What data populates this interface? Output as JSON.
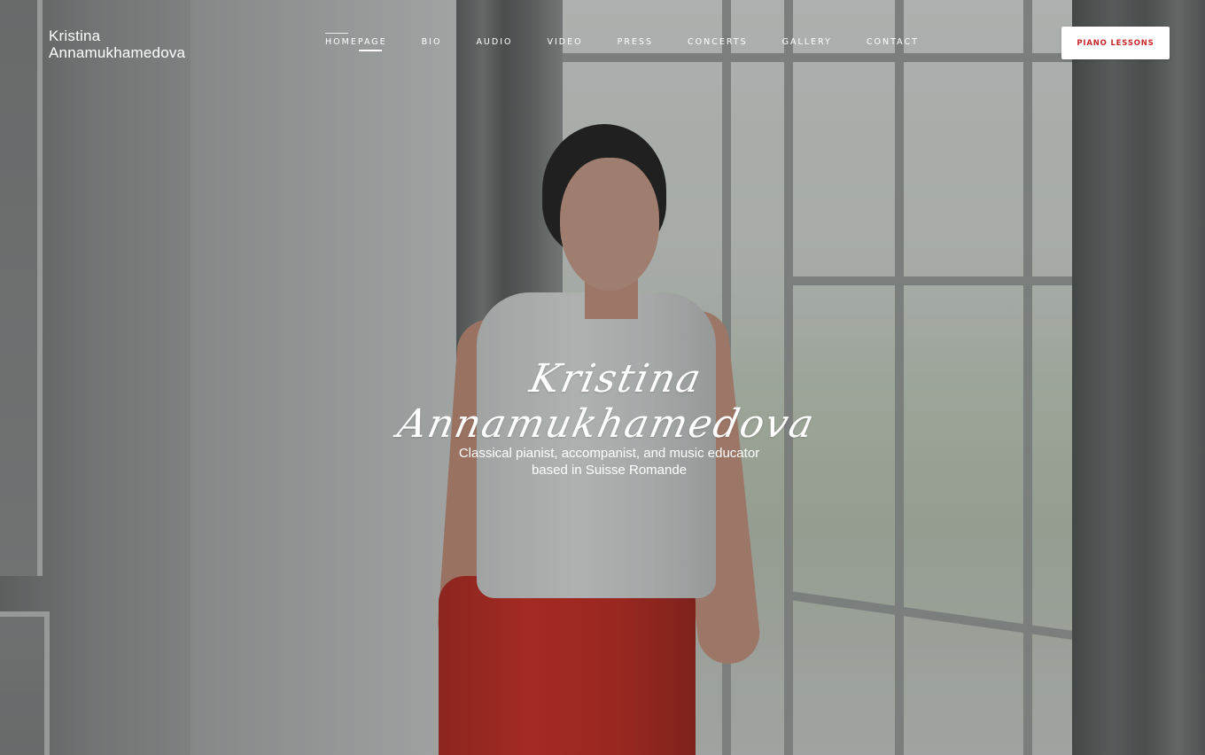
{
  "brand": {
    "line1": "Kristina",
    "line2": "Annamukhamedova"
  },
  "nav": {
    "items": [
      {
        "label": "HOMEPAGE",
        "active": true
      },
      {
        "label": "BIO",
        "active": false
      },
      {
        "label": "AUDIO",
        "active": false
      },
      {
        "label": "VIDEO",
        "active": false
      },
      {
        "label": "PRESS",
        "active": false
      },
      {
        "label": "CONCERTS",
        "active": false
      },
      {
        "label": "GALLERY",
        "active": false
      },
      {
        "label": "CONTACT",
        "active": false
      }
    ]
  },
  "cta": {
    "label": "PIANO LESSONS"
  },
  "hero": {
    "signature": "Kristina Annamukhamedova",
    "tagline_line1": "Classical pianist, accompanist, and music educator",
    "tagline_line2": "based in Suisse Romande"
  },
  "colors": {
    "accent": "#c8282a",
    "text_light": "#ffffff"
  }
}
